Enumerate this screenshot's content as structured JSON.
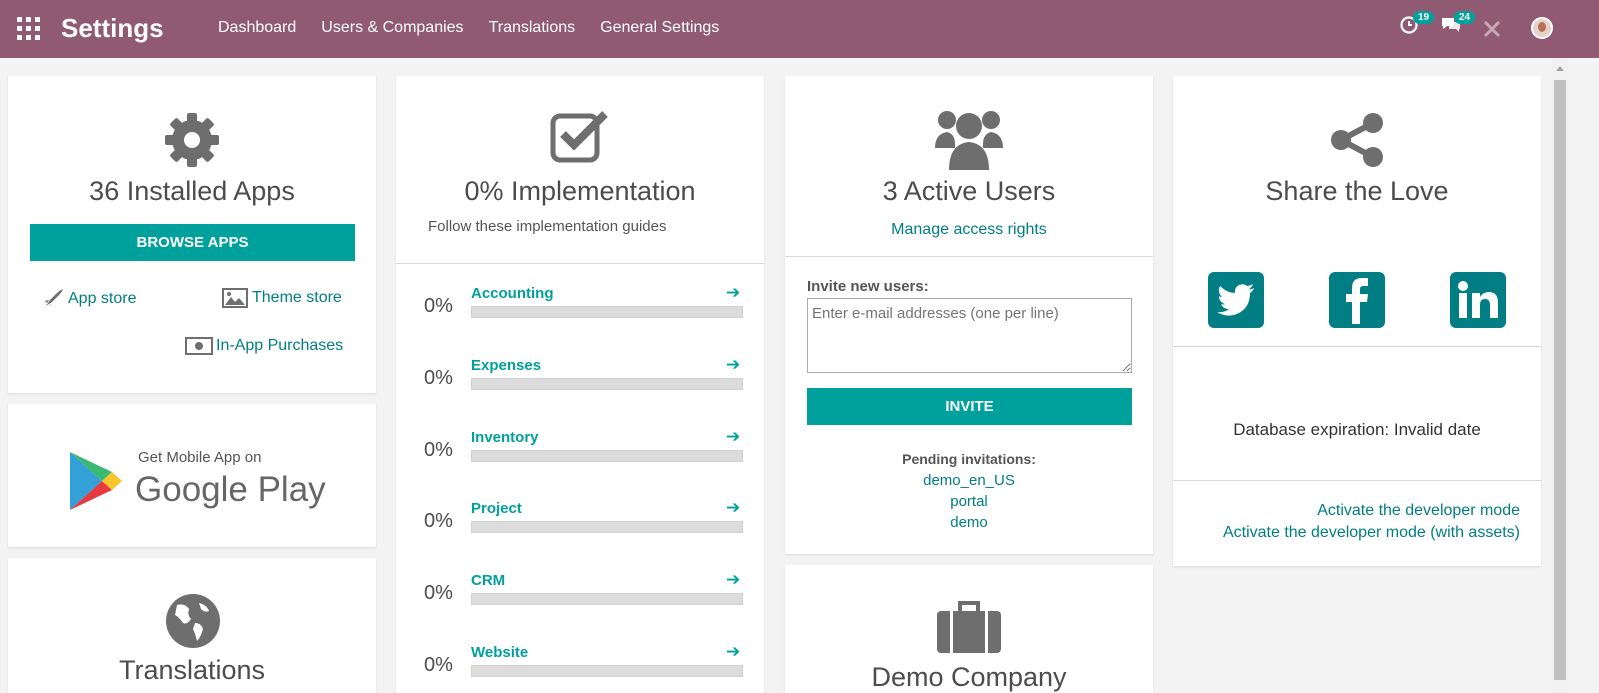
{
  "topbar": {
    "app_title": "Settings",
    "menu": [
      "Dashboard",
      "Users & Companies",
      "Translations",
      "General Settings"
    ],
    "activities_badge": "19",
    "messages_badge": "24",
    "bg_color": "#8f5a72"
  },
  "apps_card": {
    "title": "36 Installed Apps",
    "browse_button": "BROWSE APPS",
    "app_store": "App store",
    "theme_store": "Theme store",
    "in_app_purchases": "In-App Purchases"
  },
  "mobile_card": {
    "line1": "Get Mobile App on",
    "line2": "Google Play"
  },
  "translations_card": {
    "title": "Translations"
  },
  "impl_card": {
    "title": "0% Implementation",
    "subtitle": "Follow these implementation guides",
    "guides": [
      {
        "pct": "0%",
        "name": "Accounting",
        "progress": 0
      },
      {
        "pct": "0%",
        "name": "Expenses",
        "progress": 0
      },
      {
        "pct": "0%",
        "name": "Inventory",
        "progress": 0
      },
      {
        "pct": "0%",
        "name": "Project",
        "progress": 0
      },
      {
        "pct": "0%",
        "name": "CRM",
        "progress": 0
      },
      {
        "pct": "0%",
        "name": "Website",
        "progress": 0
      }
    ]
  },
  "users_card": {
    "title": "3 Active Users",
    "manage_link": "Manage access rights",
    "invite_label": "Invite new users:",
    "invite_placeholder": "Enter e-mail addresses (one per line)",
    "invite_button": "INVITE",
    "pending_label": "Pending invitations:",
    "pending": [
      "demo_en_US",
      "portal",
      "demo"
    ]
  },
  "company_card": {
    "title": "Demo Company"
  },
  "share_card": {
    "title": "Share the Love",
    "db_expiration": "Database expiration: Invalid date",
    "dev_mode": "Activate the developer mode",
    "dev_mode_assets": "Activate the developer mode (with assets)"
  },
  "accent_color": "#00a09d"
}
